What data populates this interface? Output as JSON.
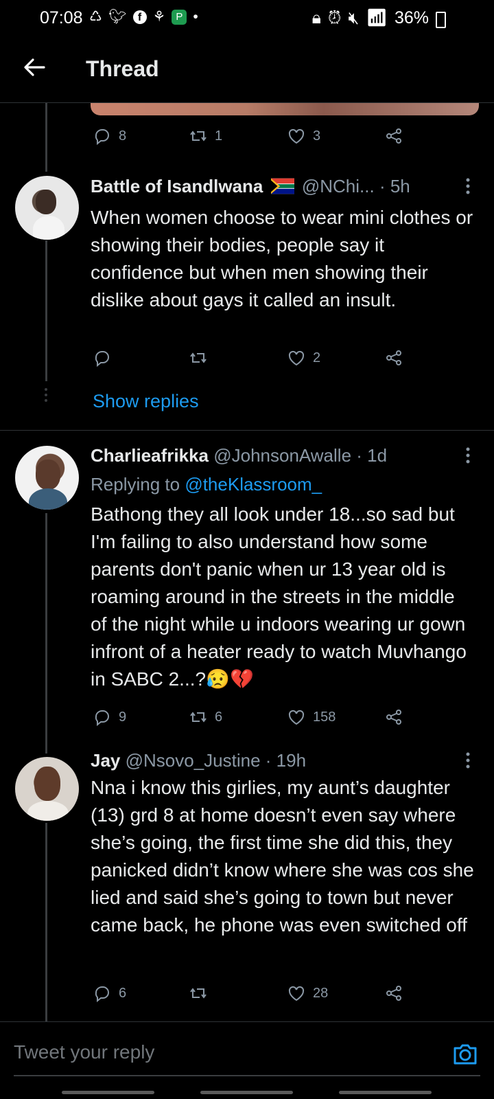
{
  "status_bar": {
    "time": "07:08",
    "battery": "36%"
  },
  "header": {
    "title": "Thread"
  },
  "tweets": [
    {
      "actions": {
        "replies": "8",
        "retweets": "1",
        "likes": "3"
      }
    },
    {
      "name": "Battle of Isandlwana",
      "handle": "@NChi...",
      "time": "· 5h",
      "text": "When women choose to wear mini clothes or showing their bodies, people say it confidence but when men showing their dislike about gays it called an insult.",
      "actions": {
        "replies": "",
        "retweets": "",
        "likes": "2"
      },
      "show_replies": "Show replies"
    },
    {
      "name": "Charlieafrikka",
      "handle": "@JohnsonAwalle",
      "time": "· 1d",
      "replying_prefix": "Replying to",
      "replying_to": "@theKlassroom_",
      "text": "Bathong they all look under 18...so sad but I'm failing to also understand how some parents don't panic when ur 13 year old is roaming around in the streets in the middle of the night while u indoors wearing ur gown infront of a heater ready to watch Muvhango in SABC 2...?",
      "emoji": "😥💔",
      "actions": {
        "replies": "9",
        "retweets": "6",
        "likes": "158"
      }
    },
    {
      "name": "Jay",
      "handle": "@Nsovo_Justine",
      "time": "· 19h",
      "text": "Nna i know this girlies, my aunt’s daughter (13) grd 8 at home doesn’t even say where she’s going, the first time she did this, they panicked didn’t know where she was cos she lied and said she’s going to town but never came back, he phone was even switched off",
      "actions": {
        "replies": "6",
        "retweets": "",
        "likes": "28"
      }
    }
  ],
  "reply_box": {
    "placeholder": "Tweet your reply"
  },
  "colors": {
    "accent": "#1d9bf0",
    "muted": "#8b98a5",
    "background": "#000000"
  },
  "icons": [
    "back-arrow-icon",
    "reply-icon",
    "retweet-icon",
    "like-icon",
    "share-icon",
    "more-icon",
    "camera-icon",
    "flag-icon"
  ]
}
